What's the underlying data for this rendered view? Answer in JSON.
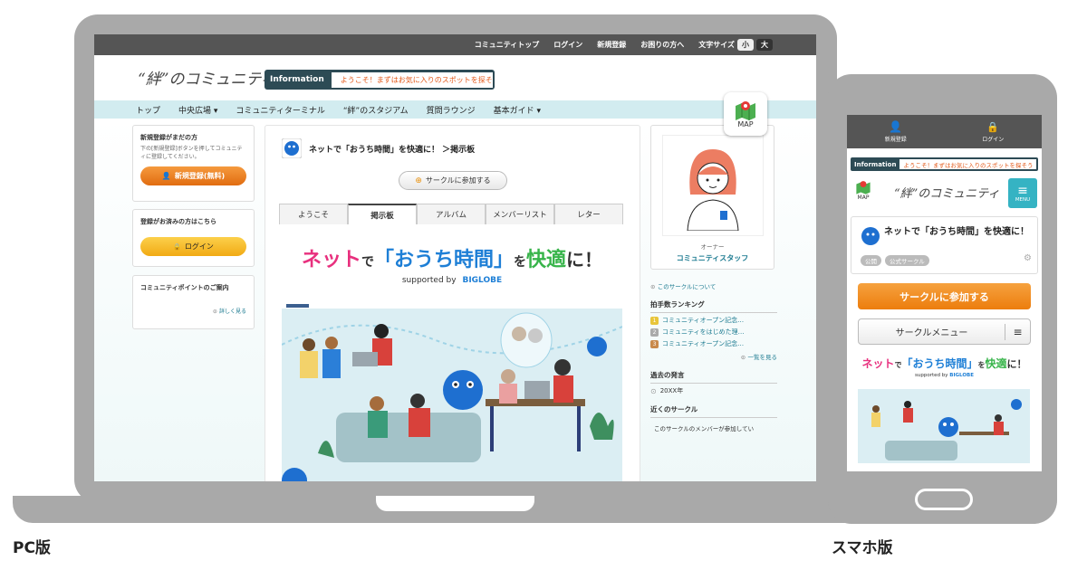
{
  "labels": {
    "pc": "PC版",
    "smartphone": "スマホ版"
  },
  "topbar": {
    "links": [
      "コミュニティトップ",
      "ログイン",
      "新規登録",
      "お困りの方へ",
      "文字サイズ"
    ],
    "size_small": "小",
    "size_large": "大"
  },
  "header": {
    "logo": "“絆”のコミュニティ",
    "info_label": "Information",
    "info_text": "ようこそ！まずはお気に入りのスポットを探そう",
    "map_label": "MAP"
  },
  "nav": {
    "items": [
      "トップ",
      "中央広場 ▾",
      "コミュニティターミナル",
      "“絆”のスタジアム",
      "質問ラウンジ",
      "基本ガイド ▾"
    ]
  },
  "left": {
    "register_title": "新規登録がまだの方",
    "register_text": "下の[新規登録]ボタンを押してコミュニティに登録してください。",
    "register_button": "新規登録(無料)",
    "login_title": "登録がお済みの方はこちら",
    "login_button": "ログイン",
    "points_title": "コミュニティポイントのご案内",
    "points_link": "詳しく見る"
  },
  "board": {
    "title": "ネットで「おうち時間」を快適に！ ＞掲示板",
    "join_button": "サークルに参加する",
    "tabs": [
      "ようこそ",
      "掲示板",
      "アルバム",
      "メンバーリスト",
      "レター"
    ],
    "active_tab": "掲示板",
    "banner_t1": "ネット",
    "banner_t2": "で",
    "banner_t3": "「おうち時間」",
    "banner_t4": "を",
    "banner_t5": "快適",
    "banner_t6": "に！",
    "banner_supported": "supported by",
    "banner_brand": "BIGLOBE"
  },
  "right": {
    "owner_role": "オーナー",
    "owner_name": "コミュニティスタッフ",
    "about_link": "このサークルについて",
    "ranking_title": "拍手数ランキング",
    "ranking": [
      "コミュニティオープン記念…",
      "コミュニティをはじめた理…",
      "コミュニティオープン記念…"
    ],
    "ranking_more": "一覧を見る",
    "past_title": "過去の発言",
    "past_year": "20XX年",
    "nearby_title": "近くのサークル",
    "nearby_text": "このサークルのメンバーが参加してい"
  },
  "phone": {
    "register": "新規登録",
    "login": "ログイン",
    "info_label": "Information",
    "info_text": "ようこそ！まずはお気に入りのスポットを探そう",
    "map_label": "MAP",
    "logo": "“絆”のコミュニティ",
    "menu_label": "MENU",
    "circle_title": "ネットで「おうち時間」を快適に！",
    "tag_public": "公開",
    "tag_official": "公式サークル",
    "join_button": "サークルに参加する",
    "menu_button": "サークルメニュー"
  },
  "colors": {
    "accent_orange": "#ec7d0d",
    "nav_bg": "#d2ecf0",
    "topbar_bg": "#555555",
    "brand_blue": "#2b7fd8"
  }
}
